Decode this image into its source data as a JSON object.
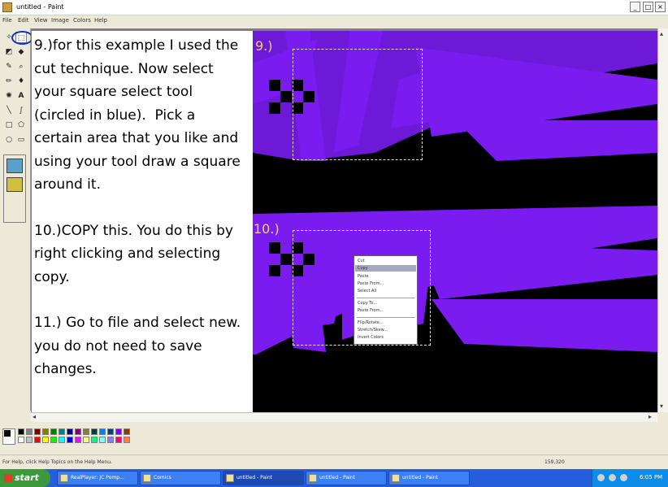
{
  "window": {
    "title": "untitled - Paint",
    "buttons": {
      "minimize": "_",
      "maximize": "□",
      "close": "×"
    }
  },
  "menu": [
    "File",
    "Edit",
    "View",
    "Image",
    "Colors",
    "Help"
  ],
  "content": {
    "paragraph1": "9.)for this example I used the\ncut technique. Now select\nyour square select tool\n(circled in blue).  Pick a\ncertain area that you like and\nusing your tool draw a square\naround it.",
    "paragraph2": "10.)COPY this. You do this by\nright clicking and selecting\ncopy.",
    "paragraph3": "11.) Go to file and select new.\nyou do not need to save\nchanges.",
    "label_step9": "9.)",
    "label_step10": "10.)"
  },
  "context_menu": [
    "Cut",
    "Copy",
    "Paste",
    "Paste From...",
    "Select All",
    "Copy To...",
    "Paste From...",
    "Flip/Rotate...",
    "Stretch/Skew...",
    "Invert Colors"
  ],
  "status": {
    "help": "For Help, click Help Topics on the Help Menu.",
    "coords": "159,320"
  },
  "taskbar": {
    "start": "start",
    "tasks": [
      "RealPlayer: JC Pomp...",
      "Comics",
      "untitled - Paint",
      "untitled - Paint",
      "untitled - Paint"
    ],
    "clock": "6:05 PM"
  },
  "colors": {
    "purple": "#7a1cf0",
    "palette": [
      "#000000",
      "#808080",
      "#800000",
      "#808000",
      "#008000",
      "#008080",
      "#000080",
      "#800080",
      "#808040",
      "#004040",
      "#0080ff",
      "#004080",
      "#8000ff",
      "#804000",
      "#ffffff",
      "#c0c0c0",
      "#ff0000",
      "#ffff00",
      "#00ff00",
      "#00ffff",
      "#0000ff",
      "#ff00ff",
      "#ffff80",
      "#00ff80",
      "#80ffff",
      "#8080ff",
      "#ff0080",
      "#ff8040"
    ]
  }
}
